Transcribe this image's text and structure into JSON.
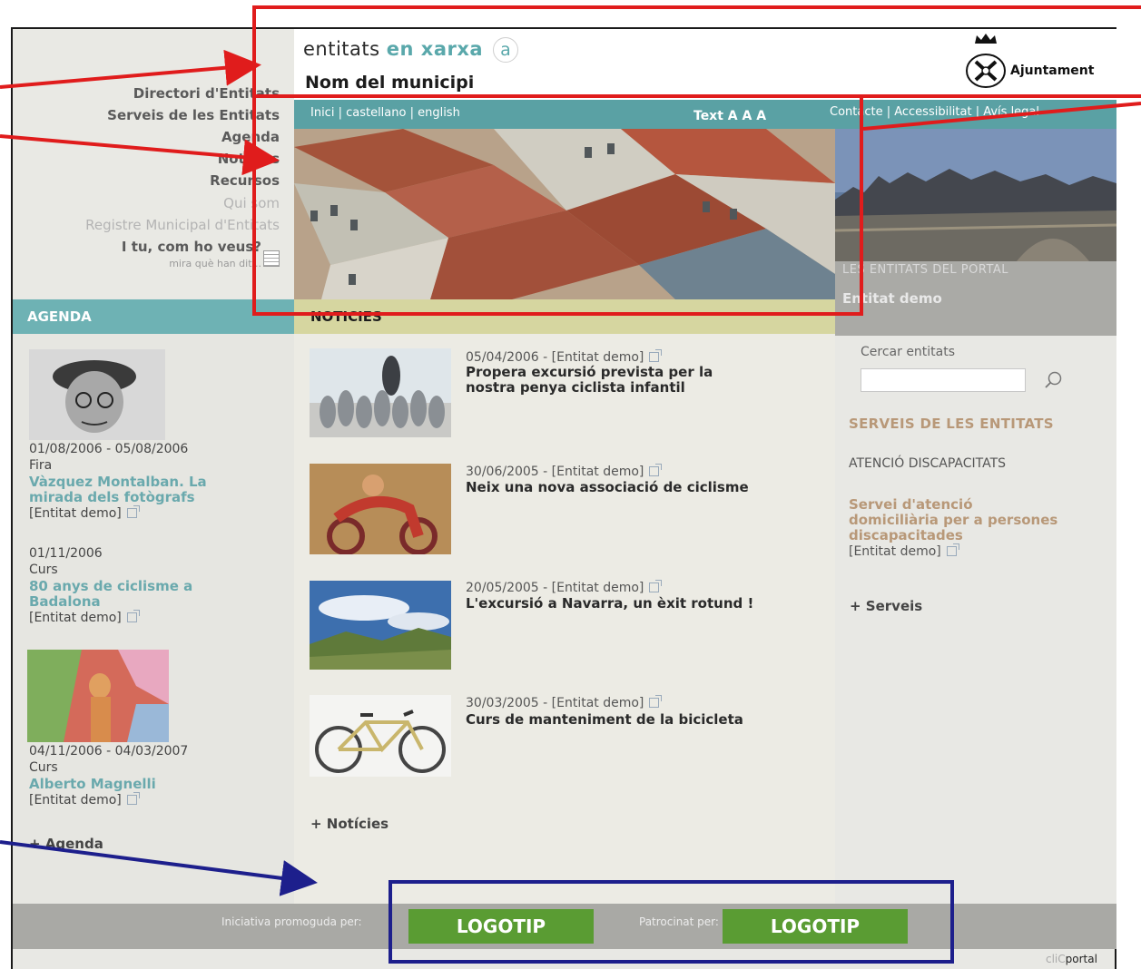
{
  "header": {
    "brand_prefix": "entitats ",
    "brand_highlight": "en xarxa",
    "brand_badge": "a",
    "municipality": "Nom del municipi",
    "ajuntament": "Ajuntament"
  },
  "nav": {
    "items": [
      {
        "label": "Directori d'Entitats"
      },
      {
        "label": "Serveis de les Entitats"
      },
      {
        "label": "Agenda"
      },
      {
        "label": "Notícies"
      },
      {
        "label": "Recursos"
      },
      {
        "label": "Qui som"
      },
      {
        "label": "Registre Municipal d'Entitats"
      },
      {
        "label": "I tu, com ho veus?"
      },
      {
        "label": "mira què han dit..."
      }
    ]
  },
  "toolbar": {
    "languages": "Inici  |  castellano  |  english",
    "text_size": "Text A A A",
    "utility": "Contacte  |  Accessibilitat  |  Avís legal"
  },
  "side_banner": {
    "label": "LES ENTITATS DEL PORTAL",
    "entity": "Entitat demo"
  },
  "agenda": {
    "heading": "AGENDA",
    "events": [
      {
        "dates": "01/08/2006 - 05/08/2006",
        "category": "Fira",
        "title_line1": "Vàzquez Montalban. La",
        "title_line2": "mirada dels fotògrafs",
        "entity": "[Entitat demo]"
      },
      {
        "dates": "01/11/2006",
        "category": "Curs",
        "title_line1": "80 anys de ciclisme a",
        "title_line2": "Badalona",
        "entity": "[Entitat demo]"
      },
      {
        "dates": "04/11/2006 - 04/03/2007",
        "category": "Curs",
        "title_line1": "Alberto Magnelli",
        "title_line2": "",
        "entity": "[Entitat demo]"
      }
    ],
    "more": "+ Agenda"
  },
  "news": {
    "heading": "NOTICIES",
    "items": [
      {
        "meta": "05/04/2006 - [Entitat demo]",
        "title_line1": "Propera excursió prevista per la",
        "title_line2": "nostra penya ciclista infantil"
      },
      {
        "meta": "30/06/2005 - [Entitat demo]",
        "title_line1": "Neix una nova associació de ciclisme",
        "title_line2": ""
      },
      {
        "meta": "20/05/2005 - [Entitat demo]",
        "title_line1": "L'excursió a Navarra, un èxit rotund !",
        "title_line2": ""
      },
      {
        "meta": "30/03/2005 - [Entitat demo]",
        "title_line1": "Curs de manteniment de la bicicleta",
        "title_line2": ""
      }
    ],
    "more": "+ Notícies"
  },
  "right": {
    "search_label": "Cercar entitats",
    "search_placeholder": "",
    "services_heading": "SERVEIS DE LES ENTITATS",
    "service_category": "ATENCIÓ DISCAPACITATS",
    "service_title_line1": "Servei d'atenció",
    "service_title_line2": "domiciliària per a persones",
    "service_title_line3": "discapacitades",
    "service_entity": "[Entitat demo]",
    "more": "+ Serveis"
  },
  "footer": {
    "promoted_by": "Iniciativa promoguda per:",
    "sponsored_by": "Patrocinat per:",
    "logo1": "LOGOTIP",
    "logo2": "LOGOTIP",
    "credit_prefix": "cliC",
    "credit_suffix": "portal"
  },
  "colors": {
    "teal": "#5aa1a4",
    "annotation_red": "#e01c1c",
    "annotation_blue": "#1d1f8c",
    "logo_green": "#5a9c33"
  }
}
